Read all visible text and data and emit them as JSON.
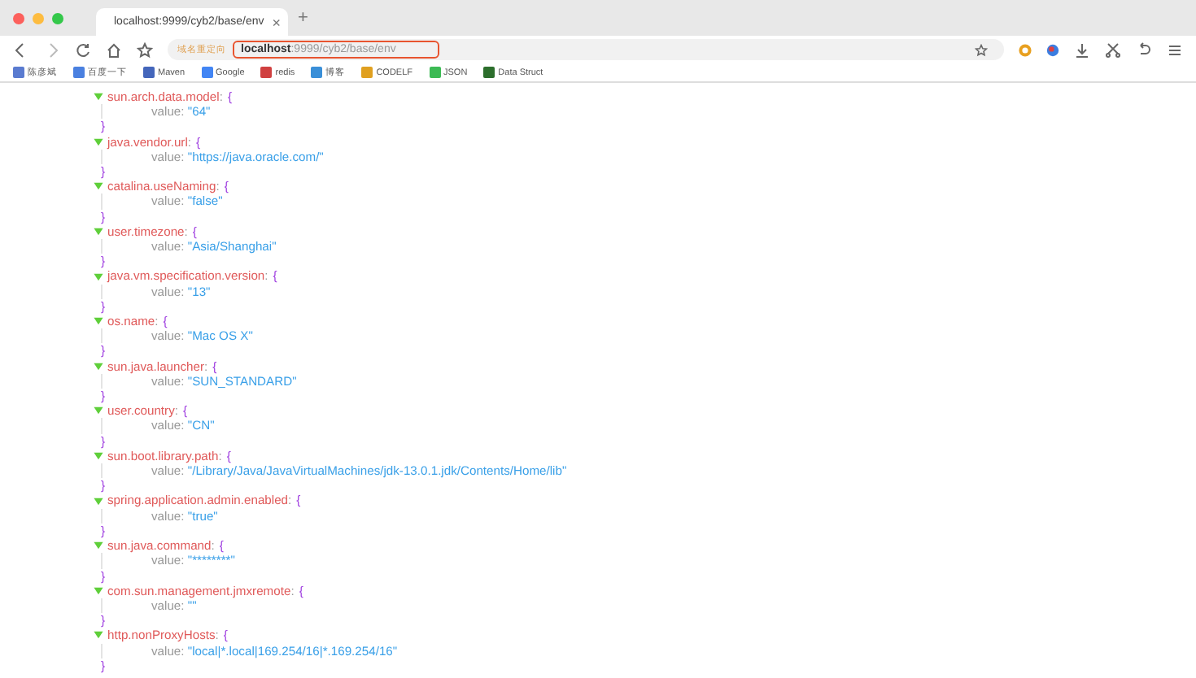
{
  "tab": {
    "title": "localhost:9999/cyb2/base/env",
    "new_tab": "+",
    "close": "×"
  },
  "address_bar": {
    "badge": "域名重定向",
    "host": "localhost",
    "path": ":9999/cyb2/base/env"
  },
  "bookmarks": [
    "陈彦斌",
    "百度一下",
    "Maven",
    "Google",
    "redis",
    "博客",
    "CODELF",
    "JSON",
    "Data Struct"
  ],
  "syntax": {
    "colon": ":",
    "open_brace": "{",
    "close_brace": "}"
  },
  "entries": [
    {
      "key": "sun.arch.data.model",
      "field": "value",
      "value": "\"64\"",
      "expanded": true
    },
    {
      "key": "java.vendor.url",
      "field": "value",
      "value": "\"https://java.oracle.com/\"",
      "expanded": true
    },
    {
      "key": "catalina.useNaming",
      "field": "value",
      "value": "\"false\"",
      "expanded": true
    },
    {
      "key": "user.timezone",
      "field": "value",
      "value": "\"Asia/Shanghai\"",
      "expanded": true
    },
    {
      "key": "java.vm.specification.version",
      "field": "value",
      "value": "\"13\"",
      "expanded": true
    },
    {
      "key": "os.name",
      "field": "value",
      "value": "\"Mac OS X\"",
      "expanded": true
    },
    {
      "key": "sun.java.launcher",
      "field": "value",
      "value": "\"SUN_STANDARD\"",
      "expanded": true
    },
    {
      "key": "user.country",
      "field": "value",
      "value": "\"CN\"",
      "expanded": true
    },
    {
      "key": "sun.boot.library.path",
      "field": "value",
      "value": "\"/Library/Java/JavaVirtualMachines/jdk-13.0.1.jdk/Contents/Home/lib\"",
      "expanded": true
    },
    {
      "key": "spring.application.admin.enabled",
      "field": "value",
      "value": "\"true\"",
      "expanded": true
    },
    {
      "key": "sun.java.command",
      "field": "value",
      "value": "\"********\"",
      "expanded": true
    },
    {
      "key": "com.sun.management.jmxremote",
      "field": "value",
      "value": "\"\"",
      "expanded": true
    },
    {
      "key": "http.nonProxyHosts",
      "field": "value",
      "value": "\"local|*.local|169.254/16|*.169.254/16\"",
      "expanded": true
    }
  ]
}
